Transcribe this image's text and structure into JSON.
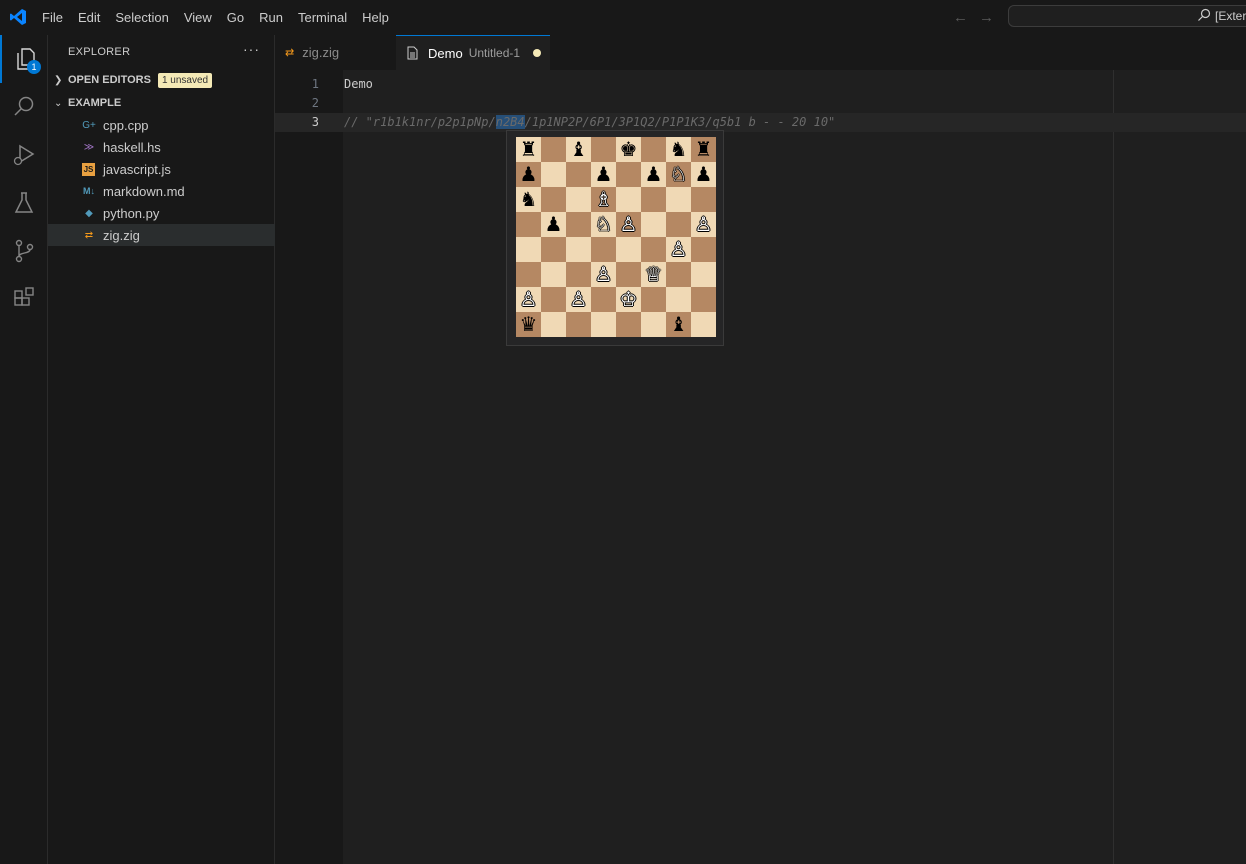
{
  "menu": [
    "File",
    "Edit",
    "Selection",
    "View",
    "Go",
    "Run",
    "Terminal",
    "Help"
  ],
  "command_center": {
    "text": "[Exter"
  },
  "activity": {
    "explorer_badge": "1"
  },
  "sidebar": {
    "title": "EXPLORER",
    "more": "···",
    "open_editors": {
      "label": "OPEN EDITORS",
      "badge": "1 unsaved"
    },
    "folder": {
      "label": "EXAMPLE"
    },
    "files": [
      {
        "name": "cpp.cpp",
        "icon": "cpp-icon",
        "glyph": "G+",
        "color": "#519aba"
      },
      {
        "name": "haskell.hs",
        "icon": "haskell-icon",
        "glyph": "≫",
        "color": "#a074c4"
      },
      {
        "name": "javascript.js",
        "icon": "javascript-icon",
        "glyph": "JS",
        "color": "#cbcb41"
      },
      {
        "name": "markdown.md",
        "icon": "markdown-icon",
        "glyph": "M↓",
        "color": "#519aba"
      },
      {
        "name": "python.py",
        "icon": "python-icon",
        "glyph": "◆",
        "color": "#519aba"
      },
      {
        "name": "zig.zig",
        "icon": "zig-icon",
        "glyph": "⇄",
        "color": "#f69a1b"
      }
    ]
  },
  "tabs": [
    {
      "label": "zig.zig",
      "icon": "zig-icon"
    },
    {
      "label": "Demo",
      "description": "Untitled-1",
      "icon": "document-icon",
      "dirty": true
    }
  ],
  "editor": {
    "lines": [
      {
        "number": "1",
        "text": "Demo"
      },
      {
        "number": "2",
        "text": ""
      },
      {
        "number": "3",
        "pre": "// \"r1b1k1nr/p2p1pNp/",
        "highlight": "n2B4",
        "post": "/1p1NP2P/6P1/3P1Q2/P1P1K3/q5b1 b - - 20 10\""
      }
    ]
  },
  "board": {
    "ranks": [
      [
        "♜",
        "",
        "♝",
        "",
        "♚",
        "",
        "♞",
        "♜"
      ],
      [
        "♟",
        "",
        "",
        "♟",
        "",
        "♟",
        "♘",
        "♟"
      ],
      [
        "♞",
        "",
        "",
        "♗",
        "",
        "",
        "",
        ""
      ],
      [
        "",
        "♟",
        "",
        "♘",
        "♙",
        "",
        "",
        "♙"
      ],
      [
        "",
        "",
        "",
        "",
        "",
        "",
        "♙",
        ""
      ],
      [
        "",
        "",
        "",
        "♙",
        "",
        "♕",
        "",
        ""
      ],
      [
        "♙",
        "",
        "♙",
        "",
        "♔",
        "",
        "",
        ""
      ],
      [
        "♛",
        "",
        "",
        "",
        "",
        "",
        "♝",
        ""
      ]
    ],
    "colors": [
      [
        "b",
        "",
        "b",
        "",
        "b",
        "",
        "b",
        "b"
      ],
      [
        "b",
        "",
        "",
        "b",
        "",
        "b",
        "w",
        "b"
      ],
      [
        "b",
        "",
        "",
        "w",
        "",
        "",
        "",
        ""
      ],
      [
        "",
        "b",
        "",
        "w",
        "w",
        "",
        "",
        "w"
      ],
      [
        "",
        "",
        "",
        "",
        "",
        "",
        "w",
        ""
      ],
      [
        "",
        "",
        "",
        "w",
        "",
        "w",
        "",
        ""
      ],
      [
        "w",
        "",
        "w",
        "",
        "w",
        "",
        "",
        ""
      ],
      [
        "b",
        "",
        "",
        "",
        "",
        "",
        "b",
        ""
      ]
    ],
    "light": "#f0d9b5",
    "dark": "#b58863"
  }
}
